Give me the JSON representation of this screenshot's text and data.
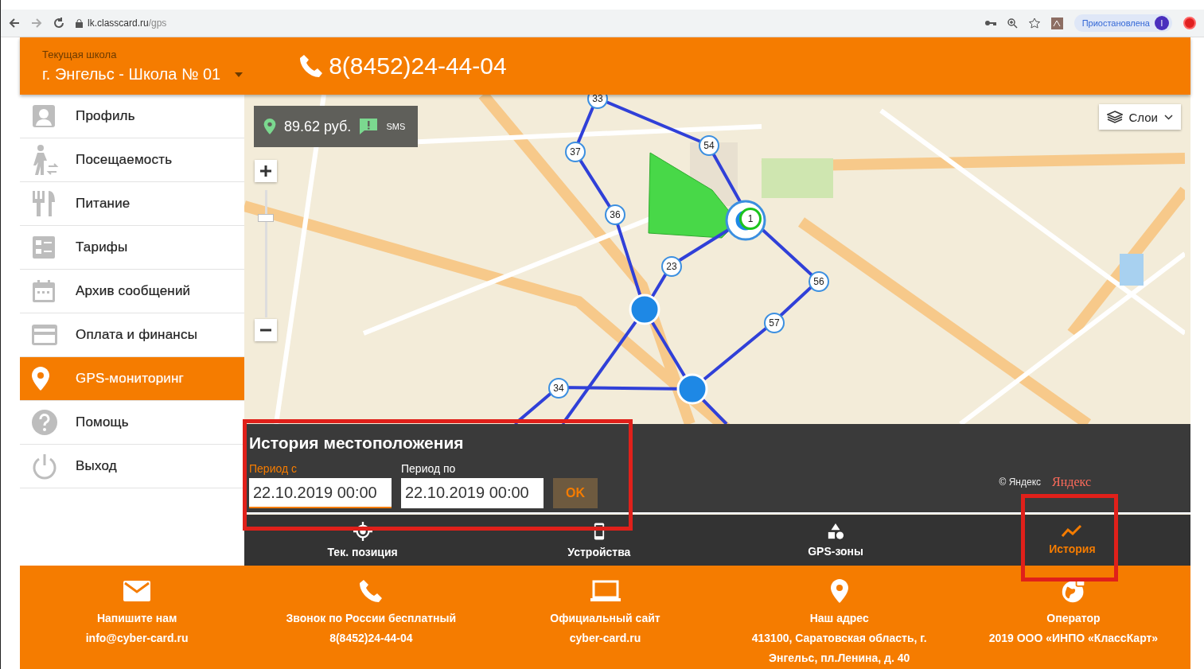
{
  "browser": {
    "url_host": "lk.classcard.ru",
    "url_path": "/gps",
    "profile_status": "Приостановлена",
    "profile_initial": "I"
  },
  "header": {
    "school_label": "Текущая школа",
    "school": "г. Энгельс - Школа № 01",
    "phone": "8(8452)24-44-04"
  },
  "sidebar": {
    "items": [
      {
        "label": "Профиль",
        "kind": "profile",
        "selected": false
      },
      {
        "label": "Посещаемость",
        "kind": "walk",
        "selected": false
      },
      {
        "label": "Питание",
        "kind": "food",
        "selected": false
      },
      {
        "label": "Тарифы",
        "kind": "list",
        "selected": false
      },
      {
        "label": "Архив сообщений",
        "kind": "calendar",
        "selected": false
      },
      {
        "label": "Оплата и финансы",
        "kind": "card",
        "selected": false
      },
      {
        "label": "GPS-мониторинг",
        "kind": "pin",
        "selected": true
      },
      {
        "label": "Помощь",
        "kind": "help",
        "selected": false
      },
      {
        "label": "Выход",
        "kind": "power",
        "selected": false
      }
    ]
  },
  "map": {
    "balance": "89.62 руб.",
    "sms_label": "SMS",
    "layers_button": "Слои",
    "zoom_slider": {
      "level": 0.8
    },
    "route_points": [
      "33",
      "37",
      "54",
      "36",
      "23",
      "1",
      "56",
      "57",
      "34"
    ],
    "attribution": "© Яндекс",
    "logo": "Яндекс"
  },
  "history_panel": {
    "title": "История местоположения",
    "fields": [
      {
        "label": "Период с",
        "value": "22.10.2019 00:00",
        "focused": true
      },
      {
        "label": "Период по",
        "value": "22.10.2019 00:00",
        "focused": false
      }
    ],
    "ok_button": "OK"
  },
  "tabs": [
    {
      "label": "Тек. позиция",
      "kind": "target",
      "selected": false
    },
    {
      "label": "Устройства",
      "kind": "phone",
      "selected": false
    },
    {
      "label": "GPS-зоны",
      "kind": "shapes",
      "selected": false
    },
    {
      "label": "История",
      "kind": "chart",
      "selected": true
    }
  ],
  "footer": [
    {
      "kind": "mail",
      "title": "Напишите нам",
      "text": "info@cyber-card.ru"
    },
    {
      "kind": "phone",
      "title": "Звонок по России бесплатный",
      "text": "8(8452)24-44-04"
    },
    {
      "kind": "laptop",
      "title": "Официальный сайт",
      "text": "cyber-card.ru"
    },
    {
      "kind": "pin",
      "title": "Наш адрес",
      "text": "413100, Саратовская область, г. Энгельс, пл.Ленина, д. 40"
    },
    {
      "kind": "globe",
      "title": "Оператор",
      "text": "2019 ООО «ИНПО «КлассКарт»"
    }
  ]
}
